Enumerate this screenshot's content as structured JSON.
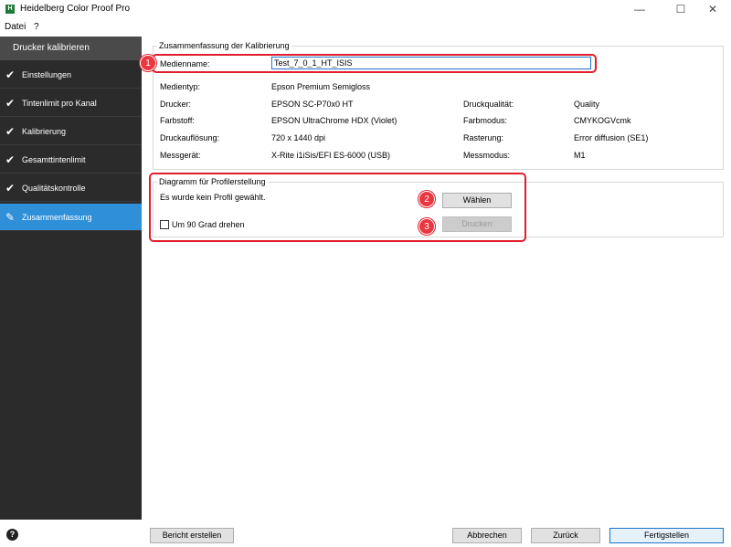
{
  "window": {
    "app_icon_letter": "H",
    "title": "Heidelberg Color Proof Pro",
    "minimize": "—",
    "maximize": "☐",
    "close": "✕"
  },
  "menu": [
    "Datei",
    "?"
  ],
  "sidebar": {
    "header": "Drucker kalibrieren",
    "items": [
      {
        "label": "Einstellungen",
        "icon": "check-icon"
      },
      {
        "label": "Tintenlimit pro Kanal",
        "icon": "check-icon"
      },
      {
        "label": "Kalibrierung",
        "icon": "check-icon"
      },
      {
        "label": "Gesamttintenlimit",
        "icon": "check-icon"
      },
      {
        "label": "Qualitätskontrolle",
        "icon": "check-icon"
      },
      {
        "label": "Zusammenfassung",
        "icon": "pencil-icon",
        "active": true
      }
    ]
  },
  "summary": {
    "legend": "Zusammenfassung der Kalibrierung",
    "medienname_label": "Medienname:",
    "medienname_value": "Test_7_0_1_HT_ISIS",
    "fields_left": [
      {
        "label": "Medientyp:",
        "value": "Epson Premium Semigloss"
      },
      {
        "label": "Drucker:",
        "value": "EPSON SC-P70x0 HT"
      },
      {
        "label": "Farbstoff:",
        "value": "EPSON UltraChrome HDX (Violet)"
      },
      {
        "label": "Druckauflösung:",
        "value": "720 x 1440 dpi"
      },
      {
        "label": "Messgerät:",
        "value": "X-Rite i1iSis/EFI ES-6000 (USB)"
      }
    ],
    "fields_right": [
      {
        "label": "Druckqualität:",
        "value": "Quality"
      },
      {
        "label": "Farbmodus:",
        "value": "CMYKOGVcmk"
      },
      {
        "label": "Rasterung:",
        "value": "Error diffusion (SE1)"
      },
      {
        "label": "Messmodus:",
        "value": "M1"
      }
    ]
  },
  "diagram": {
    "legend": "Diagramm für Profilerstellung",
    "status": "Es wurde kein Profil gewählt.",
    "select_button": "Wählen",
    "print_button": "Drucken",
    "rotate_label": "Um 90 Grad drehen"
  },
  "badges": [
    "1",
    "2",
    "3"
  ],
  "footer": {
    "help": "?",
    "report_button": "Bericht erstellen",
    "cancel_button": "Abbrechen",
    "back_button": "Zurück",
    "finish_button": "Fertigstellen"
  },
  "colors": {
    "sidebar_bg": "#2b2b2b",
    "sidebar_active": "#2f8fd8",
    "annotation_red": "#e21d2b",
    "accent_blue": "#1e73c8"
  }
}
